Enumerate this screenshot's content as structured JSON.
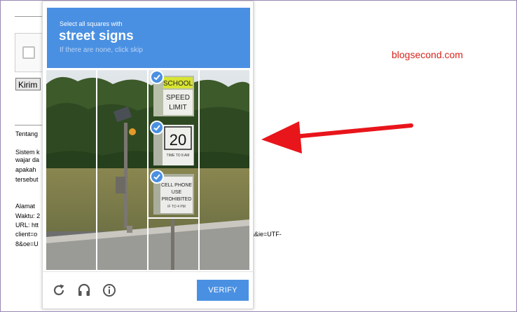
{
  "background_page": {
    "submit_label": "Kirim",
    "lines": [
      "Tentang",
      "Sistem k",
      "wajar da",
      "apakah",
      "tersebut",
      "Alamat",
      "Waktu: 2",
      "URL: htt",
      "client=o",
      "8&oe=U"
    ],
    "line_tail": "a&ie=UTF-"
  },
  "watermark": "blogsecond.com",
  "captcha": {
    "instruction": "Select all squares with",
    "target": "street signs",
    "hint": "If there are none, click skip",
    "verify_label": "VERIFY",
    "sign_school": "SCHOOL",
    "sign_speed": "SPEED",
    "sign_limit": "LIMIT",
    "sign_20": "20",
    "sign_small": "TIME TO 8 AM",
    "sign_cell1": "CELL PHONE",
    "sign_cell2": "USE",
    "sign_cell3": "PROHIBITED",
    "sign_cell4": "IF TO 4 PM"
  },
  "colors": {
    "accent": "#4a90e2",
    "arrow": "#e8151b",
    "watermark": "#d8231c"
  },
  "icons": [
    "reload-icon",
    "headphones-icon",
    "info-icon",
    "checkmark-icon"
  ]
}
